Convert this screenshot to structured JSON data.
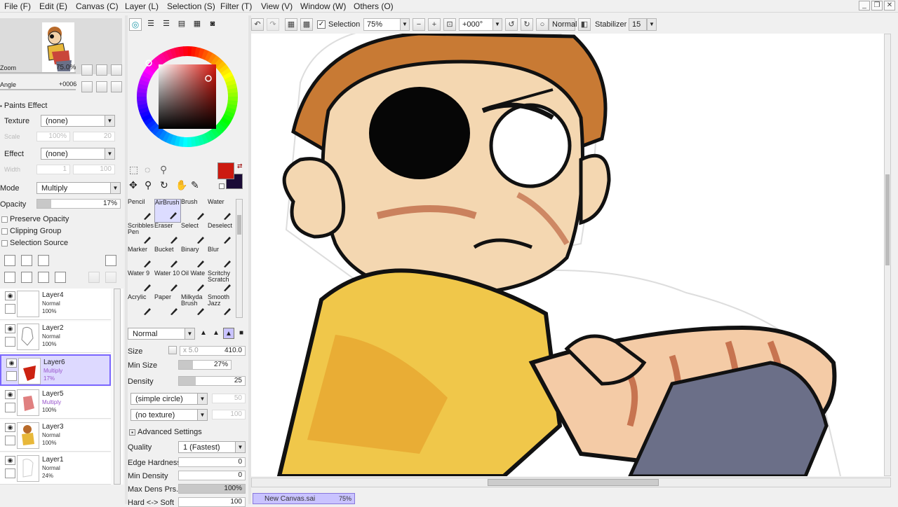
{
  "menu": [
    "File (F)",
    "Edit (E)",
    "Canvas (C)",
    "Layer (L)",
    "Selection (S)",
    "Filter (T)",
    "View (V)",
    "Window (W)",
    "Others (O)"
  ],
  "toolbar": {
    "selection_label": "Selection",
    "zoom": "75%",
    "angle": "+000°",
    "mode": "Normal",
    "stabilizer_label": "Stabilizer",
    "stabilizer_value": "15"
  },
  "navigator": {
    "zoom_label": "Zoom",
    "zoom_value": "75.0%",
    "angle_label": "Angle",
    "angle_value": "+0006"
  },
  "paints_effect": {
    "header": "Paints Effect",
    "texture_label": "Texture",
    "texture_value": "(none)",
    "scale_label": "Scale",
    "scale_value": "100%",
    "scale_num": "20",
    "effect_label": "Effect",
    "effect_value": "(none)",
    "width_label": "Width",
    "width_value": "1",
    "width_num": "100"
  },
  "layer_props": {
    "mode_label": "Mode",
    "mode_value": "Multiply",
    "opacity_label": "Opacity",
    "opacity_value": "17%",
    "opacity_fraction": 0.17,
    "preserve_opacity": "Preserve Opacity",
    "clipping_group": "Clipping Group",
    "selection_source": "Selection Source"
  },
  "layers": [
    {
      "name": "Layer4",
      "mode": "Normal",
      "opacity": "100%",
      "selected": false
    },
    {
      "name": "Layer2",
      "mode": "Normal",
      "opacity": "100%",
      "selected": false
    },
    {
      "name": "Layer6",
      "mode": "Multiply",
      "opacity": "17%",
      "selected": true
    },
    {
      "name": "Layer5",
      "mode": "Multiply",
      "opacity": "100%",
      "selected": false
    },
    {
      "name": "Layer3",
      "mode": "Normal",
      "opacity": "100%",
      "selected": false
    },
    {
      "name": "Layer1",
      "mode": "Normal",
      "opacity": "24%",
      "selected": false
    }
  ],
  "tools": [
    [
      "Pencil",
      "AirBrush",
      "Brush",
      "Water"
    ],
    [
      "Scribbles Pen",
      "Eraser",
      "Select",
      "Deselect"
    ],
    [
      "Marker",
      "Bucket",
      "Binary",
      "Blur"
    ],
    [
      "Water 9",
      "Water 10",
      "Oil Wate",
      "Scritchy Scratch"
    ],
    [
      "Acrylic",
      "Paper",
      "Milkyda Brush",
      "Smooth Jazz"
    ]
  ],
  "selected_tool": "AirBrush",
  "brush": {
    "blend_mode": "Normal",
    "size_label": "Size",
    "size_mult": "x 5.0",
    "size_value": "410.0",
    "min_size_label": "Min Size",
    "min_size_value": "27%",
    "density_label": "Density",
    "density_value": "25",
    "shape": "(simple circle)",
    "shape_num": "50",
    "texture": "(no texture)",
    "texture_num": "100",
    "advanced_label": "Advanced Settings",
    "quality_label": "Quality",
    "quality_value": "1 (Fastest)",
    "edge_label": "Edge Hardness",
    "edge_value": "0",
    "min_density_label": "Min Density",
    "min_density_value": "0",
    "max_dens_label": "Max Dens Prs.",
    "max_dens_value": "100%",
    "hard_soft_label": "Hard <-> Soft",
    "hard_soft_value": "100"
  },
  "colors": {
    "primary": "#cc1a10",
    "secondary": "#1a0b36",
    "accent": "#7a66ff"
  },
  "document_tab": {
    "name": "New Canvas.sai",
    "zoom": "75%"
  }
}
